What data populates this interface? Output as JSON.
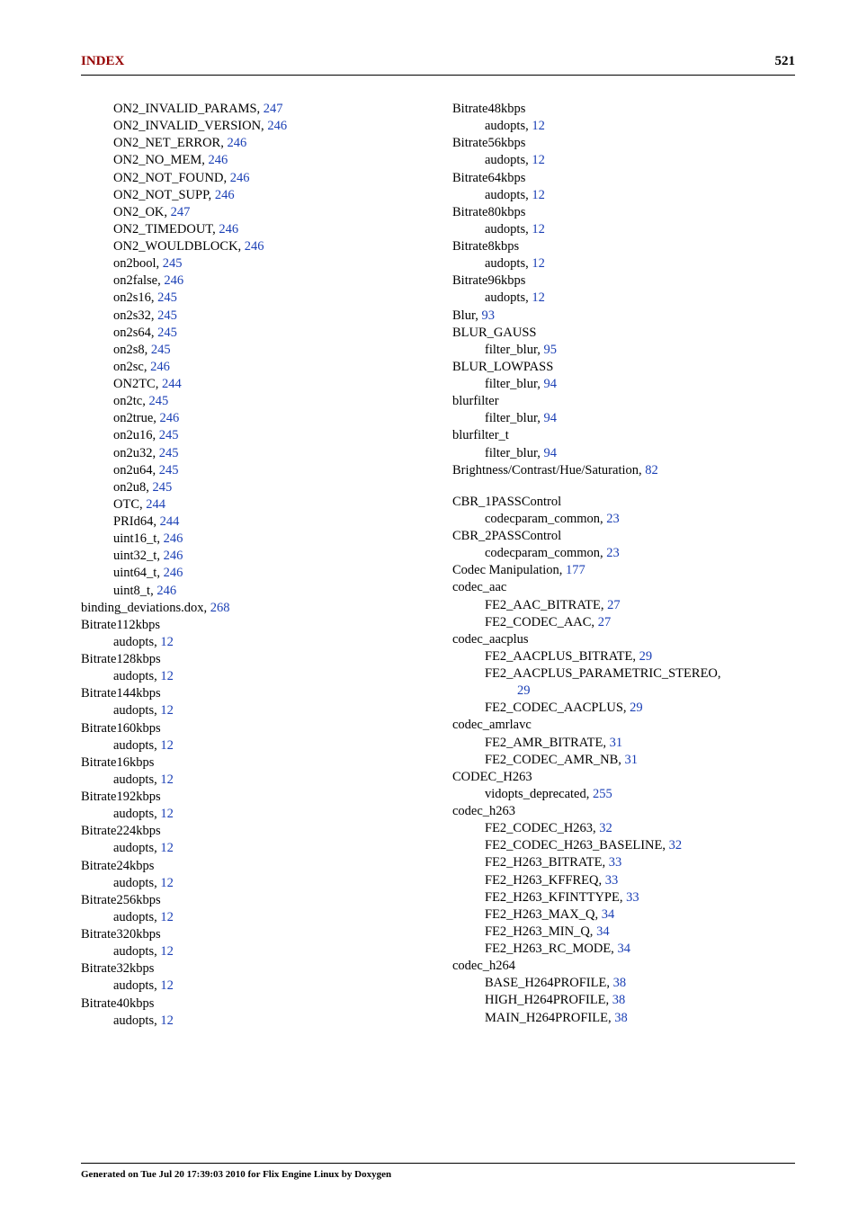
{
  "header": {
    "left": "INDEX",
    "right": "521"
  },
  "footer": {
    "generated": "Generated on Tue Jul 20 17:39:03 2010 for Flix Engine Linux by Doxygen"
  },
  "left_col": [
    {
      "indent": 1,
      "text": "ON2_INVALID_PARAMS, ",
      "page": "247"
    },
    {
      "indent": 1,
      "text": "ON2_INVALID_VERSION, ",
      "page": "246"
    },
    {
      "indent": 1,
      "text": "ON2_NET_ERROR, ",
      "page": "246"
    },
    {
      "indent": 1,
      "text": "ON2_NO_MEM, ",
      "page": "246"
    },
    {
      "indent": 1,
      "text": "ON2_NOT_FOUND, ",
      "page": "246"
    },
    {
      "indent": 1,
      "text": "ON2_NOT_SUPP, ",
      "page": "246"
    },
    {
      "indent": 1,
      "text": "ON2_OK, ",
      "page": "247"
    },
    {
      "indent": 1,
      "text": "ON2_TIMEDOUT, ",
      "page": "246"
    },
    {
      "indent": 1,
      "text": "ON2_WOULDBLOCK, ",
      "page": "246"
    },
    {
      "indent": 1,
      "text": "on2bool, ",
      "page": "245"
    },
    {
      "indent": 1,
      "text": "on2false, ",
      "page": "246"
    },
    {
      "indent": 1,
      "text": "on2s16, ",
      "page": "245"
    },
    {
      "indent": 1,
      "text": "on2s32, ",
      "page": "245"
    },
    {
      "indent": 1,
      "text": "on2s64, ",
      "page": "245"
    },
    {
      "indent": 1,
      "text": "on2s8, ",
      "page": "245"
    },
    {
      "indent": 1,
      "text": "on2sc, ",
      "page": "246"
    },
    {
      "indent": 1,
      "text": "ON2TC, ",
      "page": "244"
    },
    {
      "indent": 1,
      "text": "on2tc, ",
      "page": "245"
    },
    {
      "indent": 1,
      "text": "on2true, ",
      "page": "246"
    },
    {
      "indent": 1,
      "text": "on2u16, ",
      "page": "245"
    },
    {
      "indent": 1,
      "text": "on2u32, ",
      "page": "245"
    },
    {
      "indent": 1,
      "text": "on2u64, ",
      "page": "245"
    },
    {
      "indent": 1,
      "text": "on2u8, ",
      "page": "245"
    },
    {
      "indent": 1,
      "text": "OTC, ",
      "page": "244"
    },
    {
      "indent": 1,
      "text": "PRId64, ",
      "page": "244"
    },
    {
      "indent": 1,
      "text": "uint16_t, ",
      "page": "246"
    },
    {
      "indent": 1,
      "text": "uint32_t, ",
      "page": "246"
    },
    {
      "indent": 1,
      "text": "uint64_t, ",
      "page": "246"
    },
    {
      "indent": 1,
      "text": "uint8_t, ",
      "page": "246"
    },
    {
      "indent": 0,
      "text": "binding_deviations.dox, ",
      "page": "268"
    },
    {
      "indent": 0,
      "text": "Bitrate112kbps"
    },
    {
      "indent": 1,
      "text": "audopts, ",
      "page": "12"
    },
    {
      "indent": 0,
      "text": "Bitrate128kbps"
    },
    {
      "indent": 1,
      "text": "audopts, ",
      "page": "12"
    },
    {
      "indent": 0,
      "text": "Bitrate144kbps"
    },
    {
      "indent": 1,
      "text": "audopts, ",
      "page": "12"
    },
    {
      "indent": 0,
      "text": "Bitrate160kbps"
    },
    {
      "indent": 1,
      "text": "audopts, ",
      "page": "12"
    },
    {
      "indent": 0,
      "text": "Bitrate16kbps"
    },
    {
      "indent": 1,
      "text": "audopts, ",
      "page": "12"
    },
    {
      "indent": 0,
      "text": "Bitrate192kbps"
    },
    {
      "indent": 1,
      "text": "audopts, ",
      "page": "12"
    },
    {
      "indent": 0,
      "text": "Bitrate224kbps"
    },
    {
      "indent": 1,
      "text": "audopts, ",
      "page": "12"
    },
    {
      "indent": 0,
      "text": "Bitrate24kbps"
    },
    {
      "indent": 1,
      "text": "audopts, ",
      "page": "12"
    },
    {
      "indent": 0,
      "text": "Bitrate256kbps"
    },
    {
      "indent": 1,
      "text": "audopts, ",
      "page": "12"
    },
    {
      "indent": 0,
      "text": "Bitrate320kbps"
    },
    {
      "indent": 1,
      "text": "audopts, ",
      "page": "12"
    },
    {
      "indent": 0,
      "text": "Bitrate32kbps"
    },
    {
      "indent": 1,
      "text": "audopts, ",
      "page": "12"
    },
    {
      "indent": 0,
      "text": "Bitrate40kbps"
    },
    {
      "indent": 1,
      "text": "audopts, ",
      "page": "12"
    }
  ],
  "right_col": [
    {
      "indent": 0,
      "text": "Bitrate48kbps"
    },
    {
      "indent": 1,
      "text": "audopts, ",
      "page": "12"
    },
    {
      "indent": 0,
      "text": "Bitrate56kbps"
    },
    {
      "indent": 1,
      "text": "audopts, ",
      "page": "12"
    },
    {
      "indent": 0,
      "text": "Bitrate64kbps"
    },
    {
      "indent": 1,
      "text": "audopts, ",
      "page": "12"
    },
    {
      "indent": 0,
      "text": "Bitrate80kbps"
    },
    {
      "indent": 1,
      "text": "audopts, ",
      "page": "12"
    },
    {
      "indent": 0,
      "text": "Bitrate8kbps"
    },
    {
      "indent": 1,
      "text": "audopts, ",
      "page": "12"
    },
    {
      "indent": 0,
      "text": "Bitrate96kbps"
    },
    {
      "indent": 1,
      "text": "audopts, ",
      "page": "12"
    },
    {
      "indent": 0,
      "text": "Blur, ",
      "page": "93"
    },
    {
      "indent": 0,
      "text": "BLUR_GAUSS"
    },
    {
      "indent": 1,
      "text": "filter_blur, ",
      "page": "95"
    },
    {
      "indent": 0,
      "text": "BLUR_LOWPASS"
    },
    {
      "indent": 1,
      "text": "filter_blur, ",
      "page": "94"
    },
    {
      "indent": 0,
      "text": "blurfilter"
    },
    {
      "indent": 1,
      "text": "filter_blur, ",
      "page": "94"
    },
    {
      "indent": 0,
      "text": "blurfilter_t"
    },
    {
      "indent": 1,
      "text": "filter_blur, ",
      "page": "94"
    },
    {
      "indent": 0,
      "text": "Brightness/Contrast/Hue/Saturation, ",
      "page": "82"
    },
    {
      "spacer": true
    },
    {
      "indent": 0,
      "text": "CBR_1PASSControl"
    },
    {
      "indent": 1,
      "text": "codecparam_common, ",
      "page": "23"
    },
    {
      "indent": 0,
      "text": "CBR_2PASSControl"
    },
    {
      "indent": 1,
      "text": "codecparam_common, ",
      "page": "23"
    },
    {
      "indent": 0,
      "text": "Codec Manipulation, ",
      "page": "177"
    },
    {
      "indent": 0,
      "text": "codec_aac"
    },
    {
      "indent": 1,
      "text": "FE2_AAC_BITRATE, ",
      "page": "27"
    },
    {
      "indent": 1,
      "text": "FE2_CODEC_AAC, ",
      "page": "27"
    },
    {
      "indent": 0,
      "text": "codec_aacplus"
    },
    {
      "indent": 1,
      "text": "FE2_AACPLUS_BITRATE, ",
      "page": "29"
    },
    {
      "indent": 1,
      "text": "FE2_AACPLUS_PARAMETRIC_STEREO,"
    },
    {
      "indent": 2,
      "page": "29"
    },
    {
      "indent": 1,
      "text": "FE2_CODEC_AACPLUS, ",
      "page": "29"
    },
    {
      "indent": 0,
      "text": "codec_amrlavc"
    },
    {
      "indent": 1,
      "text": "FE2_AMR_BITRATE, ",
      "page": "31"
    },
    {
      "indent": 1,
      "text": "FE2_CODEC_AMR_NB, ",
      "page": "31"
    },
    {
      "indent": 0,
      "text": "CODEC_H263"
    },
    {
      "indent": 1,
      "text": "vidopts_deprecated, ",
      "page": "255"
    },
    {
      "indent": 0,
      "text": "codec_h263"
    },
    {
      "indent": 1,
      "text": "FE2_CODEC_H263, ",
      "page": "32"
    },
    {
      "indent": 1,
      "text": "FE2_CODEC_H263_BASELINE, ",
      "page": "32"
    },
    {
      "indent": 1,
      "text": "FE2_H263_BITRATE, ",
      "page": "33"
    },
    {
      "indent": 1,
      "text": "FE2_H263_KFFREQ, ",
      "page": "33"
    },
    {
      "indent": 1,
      "text": "FE2_H263_KFINTTYPE, ",
      "page": "33"
    },
    {
      "indent": 1,
      "text": "FE2_H263_MAX_Q, ",
      "page": "34"
    },
    {
      "indent": 1,
      "text": "FE2_H263_MIN_Q, ",
      "page": "34"
    },
    {
      "indent": 1,
      "text": "FE2_H263_RC_MODE, ",
      "page": "34"
    },
    {
      "indent": 0,
      "text": "codec_h264"
    },
    {
      "indent": 1,
      "text": "BASE_H264PROFILE, ",
      "page": "38"
    },
    {
      "indent": 1,
      "text": "HIGH_H264PROFILE, ",
      "page": "38"
    },
    {
      "indent": 1,
      "text": "MAIN_H264PROFILE, ",
      "page": "38"
    }
  ]
}
